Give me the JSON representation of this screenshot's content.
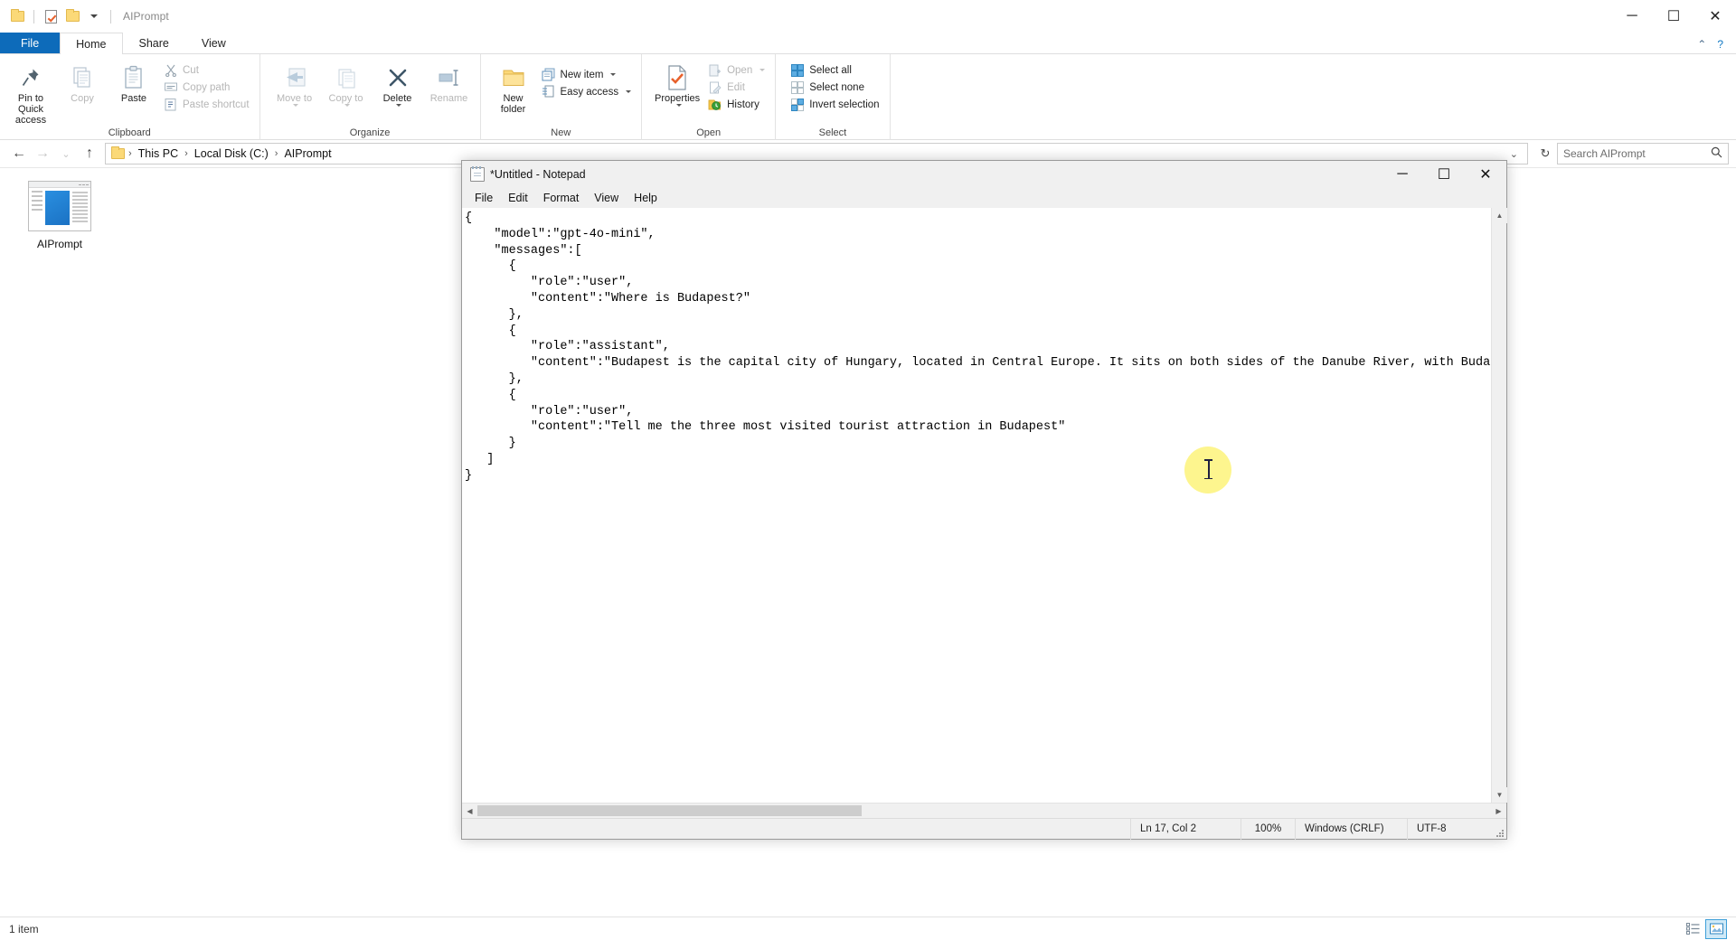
{
  "explorer": {
    "window_title": "AIPrompt",
    "quick_access": [
      {
        "name": "folder-icon",
        "label": "folder"
      },
      {
        "name": "properties-icon",
        "label": "properties"
      },
      {
        "name": "new-folder-icon",
        "label": "new folder"
      },
      {
        "name": "customize-caret-icon",
        "label": "customize"
      }
    ],
    "window_controls": {
      "minimize": "─",
      "maximize": "☐",
      "close": "✕"
    },
    "ribbon_controls": {
      "collapse": "⌃",
      "help": "?"
    },
    "tabs": [
      {
        "label": "File",
        "type": "file"
      },
      {
        "label": "Home",
        "type": "active"
      },
      {
        "label": "Share",
        "type": "normal"
      },
      {
        "label": "View",
        "type": "normal"
      }
    ],
    "groups": [
      {
        "label": "Clipboard",
        "big": [
          {
            "label": "Pin to Quick access",
            "icon": "pin-icon",
            "dim": false
          },
          {
            "label": "Copy",
            "icon": "copy-icon",
            "dim": true
          },
          {
            "label": "Paste",
            "icon": "paste-icon",
            "dim": false
          }
        ],
        "small": [
          {
            "label": "Cut",
            "icon": "scissors-icon",
            "dim": true
          },
          {
            "label": "Copy path",
            "icon": "copy-path-icon",
            "dim": true
          },
          {
            "label": "Paste shortcut",
            "icon": "paste-shortcut-icon",
            "dim": true
          }
        ]
      },
      {
        "label": "Organize",
        "big": [
          {
            "label": "Move to",
            "icon": "move-to-icon",
            "dim": true,
            "caret": true
          },
          {
            "label": "Copy to",
            "icon": "copy-to-icon",
            "dim": true,
            "caret": true
          },
          {
            "label": "Delete",
            "icon": "delete-icon",
            "dim": false,
            "caret": true
          },
          {
            "label": "Rename",
            "icon": "rename-icon",
            "dim": true
          }
        ],
        "small": []
      },
      {
        "label": "New",
        "big": [
          {
            "label": "New folder",
            "icon": "new-folder-icon",
            "dim": false
          }
        ],
        "small": [
          {
            "label": "New item",
            "icon": "new-item-icon",
            "dim": false,
            "caret": true
          },
          {
            "label": "Easy access",
            "icon": "easy-access-icon",
            "dim": false,
            "caret": true
          }
        ]
      },
      {
        "label": "Open",
        "big": [
          {
            "label": "Properties",
            "icon": "properties-icon",
            "dim": false,
            "caret": true
          }
        ],
        "small": [
          {
            "label": "Open",
            "icon": "open-icon",
            "dim": true,
            "caret": true
          },
          {
            "label": "Edit",
            "icon": "edit-icon",
            "dim": true
          },
          {
            "label": "History",
            "icon": "history-icon",
            "dim": false
          }
        ]
      },
      {
        "label": "Select",
        "big": [],
        "small": [
          {
            "label": "Select all",
            "icon": "select-all-icon",
            "dim": false
          },
          {
            "label": "Select none",
            "icon": "select-none-icon",
            "dim": false
          },
          {
            "label": "Invert selection",
            "icon": "invert-selection-icon",
            "dim": false
          }
        ]
      }
    ],
    "nav": {
      "back": "←",
      "forward": "→",
      "recent": "⌄",
      "up": "↑",
      "refresh": "↻",
      "dropdown": "⌄"
    },
    "breadcrumb": [
      "This PC",
      "Local Disk (C:)",
      "AIPrompt"
    ],
    "breadcrumb_separator": "›",
    "search": {
      "placeholder": "Search AIPrompt",
      "icon": "search-icon"
    },
    "files": [
      {
        "label": "AIPrompt",
        "icon": "document-thumbnail"
      }
    ],
    "status": {
      "item_count": "1 item"
    },
    "view_buttons": [
      {
        "name": "details-view-button",
        "selected": false
      },
      {
        "name": "large-icons-view-button",
        "selected": true
      }
    ]
  },
  "notepad": {
    "title": "*Untitled - Notepad",
    "menu": [
      "File",
      "Edit",
      "Format",
      "View",
      "Help"
    ],
    "window_controls": {
      "minimize": "─",
      "maximize": "☐",
      "close": "✕"
    },
    "scrollbar": {
      "up": "▲",
      "down": "▼",
      "left": "◀",
      "right": "▶"
    },
    "content": "{\n    \"model\":\"gpt-4o-mini\",\n    \"messages\":[\n      {\n         \"role\":\"user\",\n         \"content\":\"Where is Budapest?\"\n      },\n      {\n         \"role\":\"assistant\",\n         \"content\":\"Budapest is the capital city of Hungary, located in Central Europe. It sits on both sides of the Danube River, with Buda c\n      },\n      {\n         \"role\":\"user\",\n         \"content\":\"Tell me the three most visited tourist attraction in Budapest\"\n      }\n   ]\n}",
    "status": {
      "position": "Ln 17, Col 2",
      "zoom": "100%",
      "line_ending": "Windows (CRLF)",
      "encoding": "UTF-8"
    }
  },
  "colors": {
    "accent": "#0d6bba",
    "highlight": "#fdf58e",
    "folder": "#fbd978"
  }
}
